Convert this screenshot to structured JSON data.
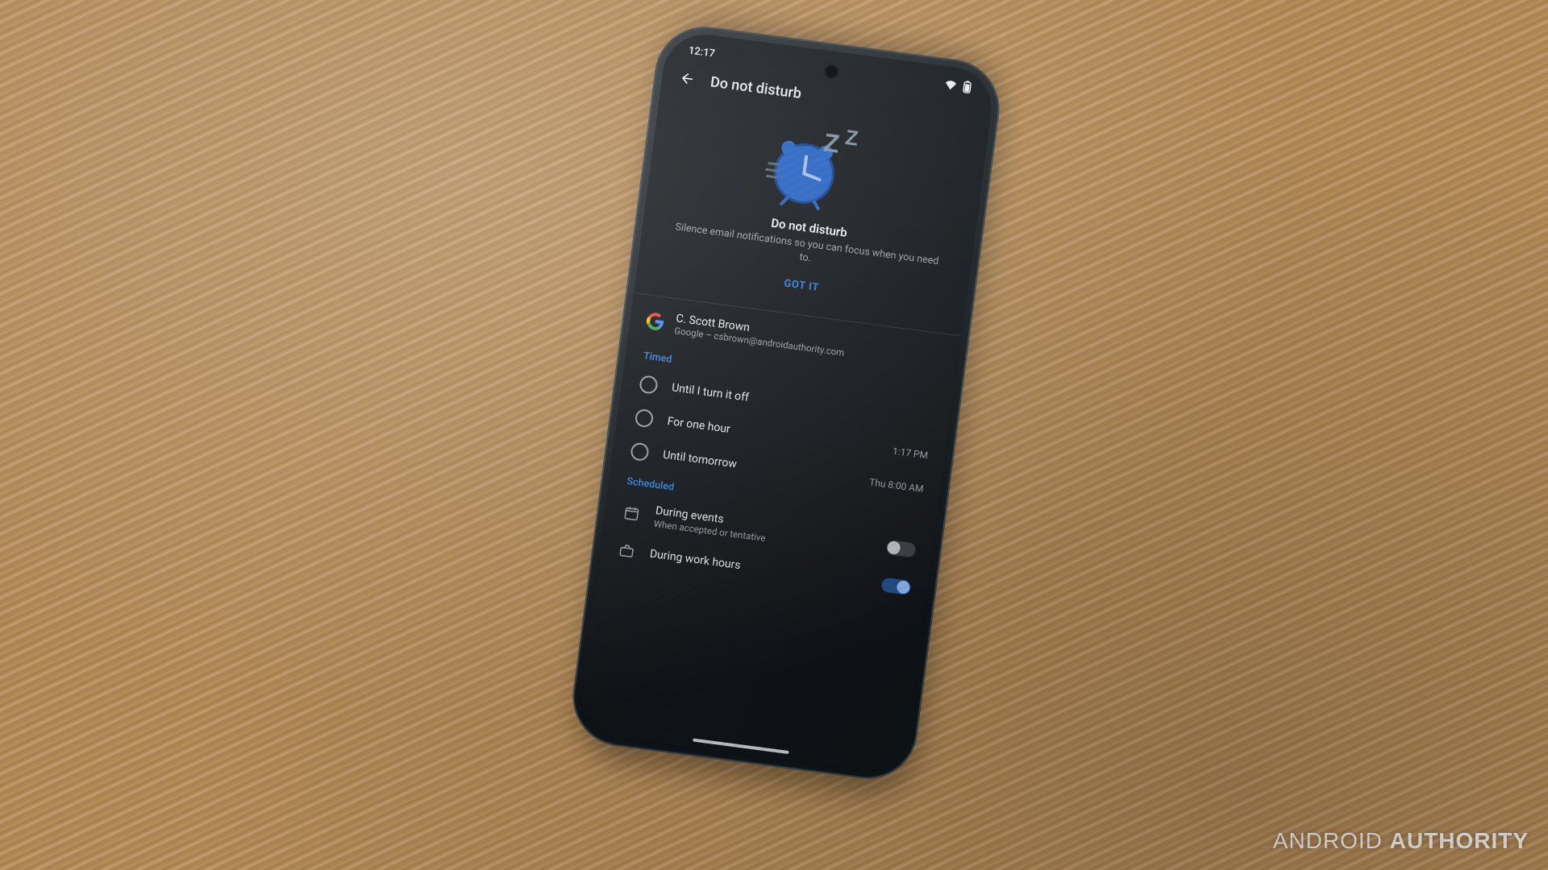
{
  "statusbar": {
    "time": "12:17"
  },
  "appbar": {
    "title": "Do not disturb"
  },
  "hero": {
    "title": "Do not disturb",
    "subtitle": "Silence email notifications so you can focus when you need to.",
    "cta": "GOT IT"
  },
  "account": {
    "name": "C. Scott Brown",
    "detail": "Google – csbrown@androidauthority.com"
  },
  "sections": {
    "timed": {
      "label": "Timed",
      "options": [
        {
          "label": "Until I turn it off",
          "trail": ""
        },
        {
          "label": "For one hour",
          "trail": "1:17 PM"
        },
        {
          "label": "Until tomorrow",
          "trail": "Thu 8:00 AM"
        }
      ]
    },
    "scheduled": {
      "label": "Scheduled",
      "items": [
        {
          "label": "During events",
          "sub": "When accepted or tentative",
          "toggle": "off",
          "icon": "calendar-icon"
        },
        {
          "label": "During work hours",
          "sub": "",
          "toggle": "on",
          "icon": "briefcase-icon"
        }
      ]
    }
  },
  "watermark": {
    "brand_a": "ANDROID",
    "brand_b": "AUTHORITY"
  },
  "colors": {
    "accent": "#2a7de1",
    "hero_blue": "#1f5fc4"
  }
}
